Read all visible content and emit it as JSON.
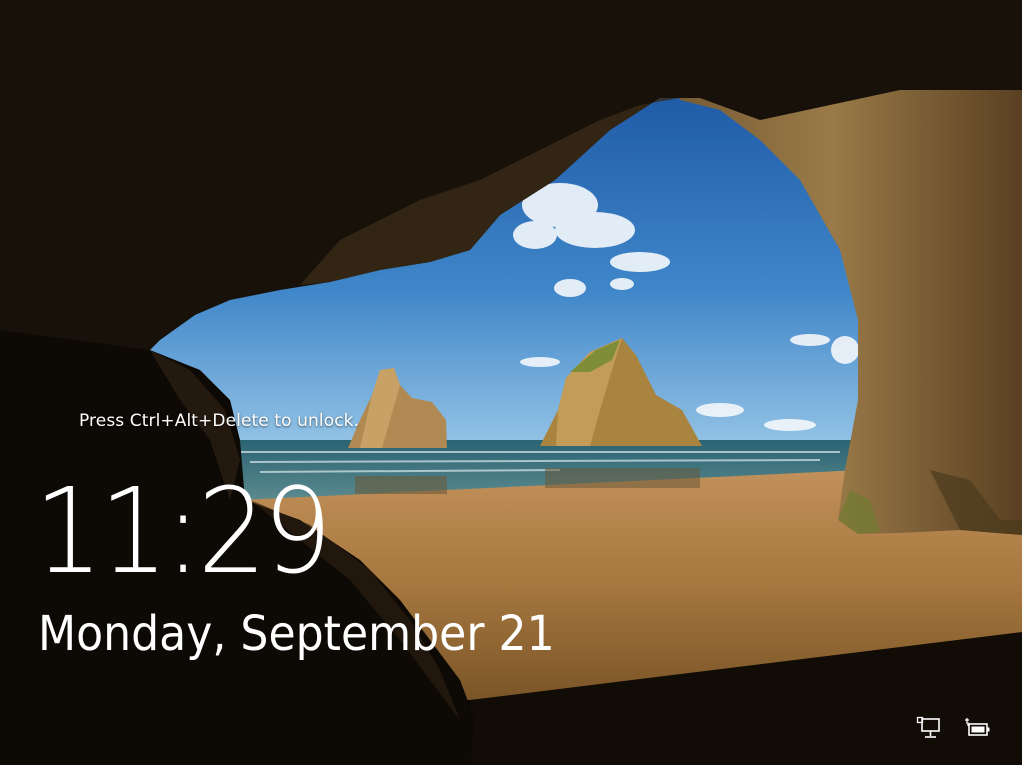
{
  "lock_screen": {
    "unlock_hint": "Press Ctrl+Alt+Delete to unlock.",
    "time": "11:29",
    "date": "Monday, September 21"
  },
  "tray": {
    "icons": [
      {
        "name": "network-icon"
      },
      {
        "name": "battery-icon"
      }
    ]
  },
  "colors": {
    "sky_top": "#1f5fa8",
    "sky_bottom": "#8bc0e4",
    "sea": "#2e6a7c",
    "sand": "#b5864f",
    "cave": "#1a1208",
    "text": "#ffffff"
  }
}
